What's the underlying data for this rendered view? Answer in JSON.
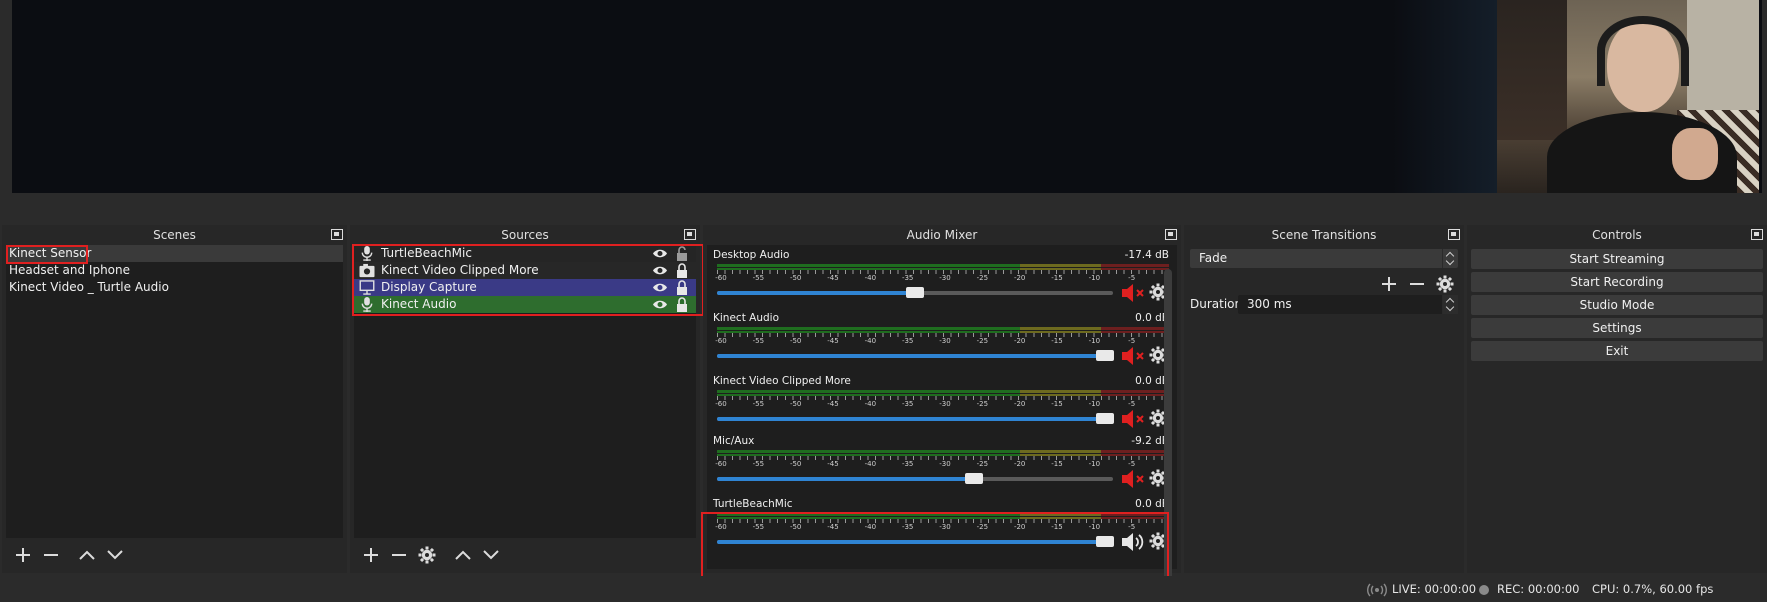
{
  "scenes": {
    "title": "Scenes",
    "items": [
      "Kinect Sensor",
      "Headset and Iphone",
      "Kinect Video _ Turtle Audio"
    ]
  },
  "sources": {
    "title": "Sources",
    "items": [
      {
        "name": "TurtleBeachMic",
        "icon": "microphone-icon"
      },
      {
        "name": "Kinect Video Clipped More",
        "icon": "camera-icon"
      },
      {
        "name": "Display Capture",
        "icon": "monitor-icon"
      },
      {
        "name": "Kinect Audio",
        "icon": "microphone-icon"
      }
    ]
  },
  "mixer": {
    "title": "Audio Mixer",
    "scale": [
      "-60",
      "-55",
      "-50",
      "-45",
      "-40",
      "-35",
      "-30",
      "-25",
      "-20",
      "-15",
      "-10",
      "-5",
      "0"
    ],
    "channels": [
      {
        "name": "Desktop Audio",
        "db": "-17.4 dB",
        "level": 0.5,
        "muted": true
      },
      {
        "name": "Kinect Audio",
        "db": "0.0 dB",
        "level": 1.0,
        "muted": true
      },
      {
        "name": "Kinect Video Clipped More",
        "db": "0.0 dB",
        "level": 1.0,
        "muted": true
      },
      {
        "name": "Mic/Aux",
        "db": "-9.2 dB",
        "level": 0.65,
        "muted": true
      },
      {
        "name": "TurtleBeachMic",
        "db": "0.0 dB",
        "level": 1.0,
        "muted": false
      }
    ]
  },
  "transitions": {
    "title": "Scene Transitions",
    "selected": "Fade",
    "duration_label": "Duration",
    "duration_value": "300 ms"
  },
  "controls": {
    "title": "Controls",
    "buttons": [
      "Start Streaming",
      "Start Recording",
      "Studio Mode",
      "Settings",
      "Exit"
    ]
  },
  "status": {
    "live": "LIVE: 00:00:00",
    "rec": "REC: 00:00:00",
    "cpu": "CPU: 0.7%, 60.00 fps"
  },
  "colors": {
    "accent_blue": "#2f84d3",
    "muted_red": "#e02020",
    "highlight_red_box": "#e02020"
  }
}
